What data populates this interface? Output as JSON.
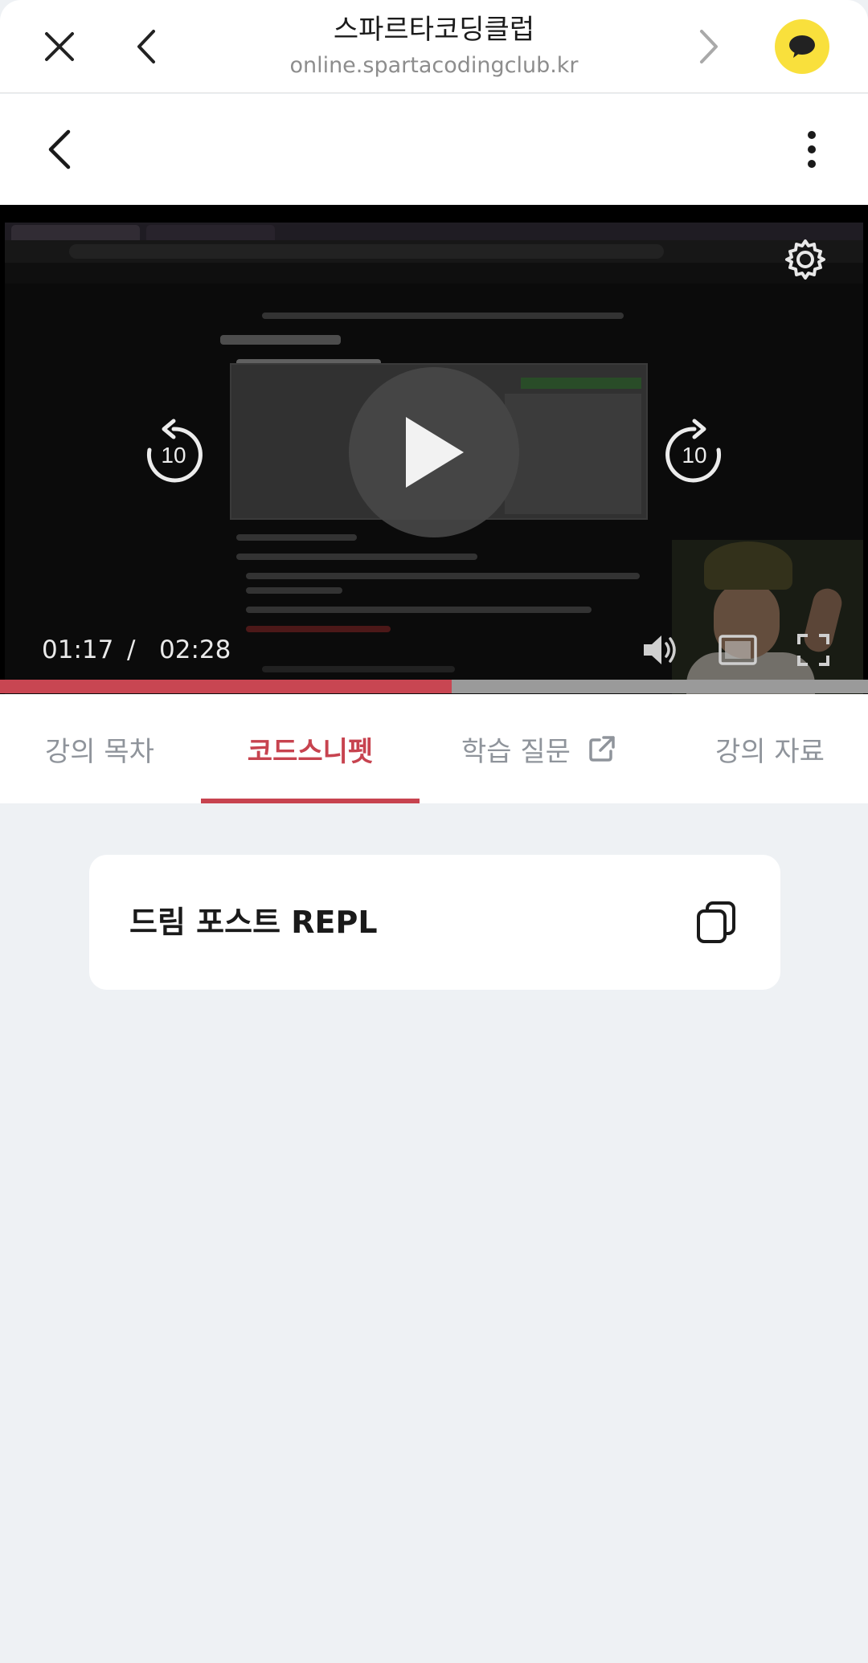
{
  "browser": {
    "title": "스파르타코딩클럽",
    "url": "online.spartacodingclub.kr",
    "close_icon": "close-icon",
    "back_icon": "chevron-left-icon",
    "forward_icon": "chevron-right-icon",
    "share_icon": "kakaotalk-icon",
    "share_color": "#F9E03C"
  },
  "page_header": {
    "back_icon": "chevron-left-icon",
    "more_icon": "more-vertical-icon"
  },
  "player": {
    "state": "paused",
    "current_time": "01:17",
    "separator": "/",
    "duration": "02:28",
    "progress_fraction": 0.52,
    "progress_color": "#C84652",
    "seek_back_label": "10",
    "seek_forward_label": "10",
    "icons": [
      "gear-icon",
      "replay-10-icon",
      "play-icon",
      "forward-10-icon",
      "volume-icon",
      "theater-mode-icon",
      "fullscreen-icon"
    ]
  },
  "tabs": [
    {
      "label": "강의 목차",
      "active": false
    },
    {
      "label": "코드스니펫",
      "active": true
    },
    {
      "label": "학습 질문",
      "active": false,
      "external": true
    },
    {
      "label": "강의 자료",
      "active": false
    }
  ],
  "accent_color": "#C7434F",
  "snippets": [
    {
      "title": "드림 포스트 REPL",
      "icon": "copy-icon"
    }
  ]
}
